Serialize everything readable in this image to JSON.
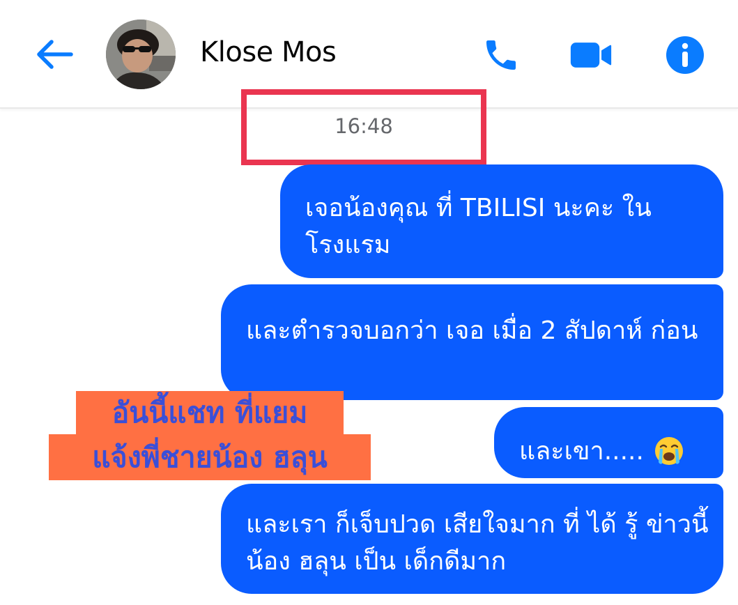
{
  "header": {
    "contact_name": "Klose Mos",
    "icons": {
      "back": "back-arrow-icon",
      "call": "phone-icon",
      "video": "video-camera-icon",
      "info": "info-icon"
    },
    "accent_color": "#0a7cff"
  },
  "chat": {
    "timestamp": "16:48",
    "highlight_color": "#ea3550",
    "bubble_color": "#0a5cff",
    "messages": [
      {
        "text": "เจอน้องคุณ ที่ TBILISI นะคะ ใน โรงแรม"
      },
      {
        "text": "และตำรวจบอกว่า เจอ เมื่อ 2 สัปดาห์ ก่อน"
      },
      {
        "text": "และเขา.....",
        "emoji": "loudly-crying-face"
      },
      {
        "text": "และเรา ก็เจ็บปวด เสียใจมาก ที่ ได้ รู้ ข่าวนี้ น้อง ฮลุน เป็น เด็กดีมาก"
      }
    ]
  },
  "annotation": {
    "line1": "อันนี้แชท ที่แยม",
    "line2": "แจ้งพี่ชายน้อง ฮลุน",
    "background": "#ff7043",
    "text_color": "#3a4fd8"
  }
}
